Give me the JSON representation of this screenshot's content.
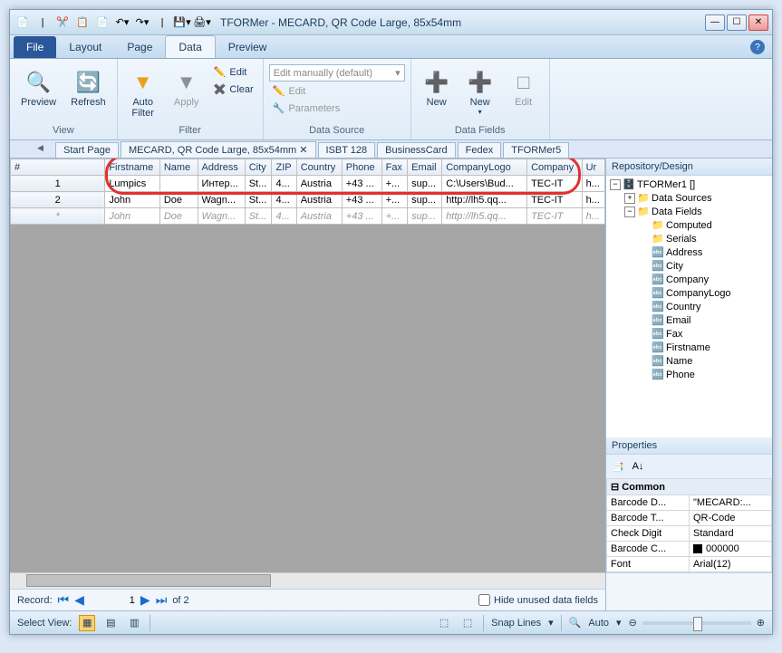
{
  "app": {
    "title": "TFORMer - MECARD, QR Code Large, 85x54mm"
  },
  "tabs": {
    "file": "File",
    "layout": "Layout",
    "page": "Page",
    "data": "Data",
    "preview": "Preview"
  },
  "ribbon": {
    "view": {
      "preview": "Preview",
      "refresh": "Refresh",
      "group": "View"
    },
    "filter": {
      "auto": "Auto\nFilter",
      "apply": "Apply",
      "edit": "Edit",
      "clear": "Clear",
      "group": "Filter"
    },
    "datasource": {
      "combo": "Edit manually (default)",
      "edit": "Edit",
      "params": "Parameters",
      "group": "Data Source"
    },
    "datafields": {
      "new1": "New",
      "new2": "New",
      "edit": "Edit",
      "group": "Data Fields"
    }
  },
  "docTabs": [
    "Start Page",
    "MECARD, QR Code Large, 85x54mm",
    "ISBT 128",
    "BusinessCard",
    "Fedex",
    "TFORMer5"
  ],
  "grid": {
    "headers": [
      "#",
      "Firstname",
      "Name",
      "Address",
      "City",
      "ZIP",
      "Country",
      "Phone",
      "Fax",
      "Email",
      "CompanyLogo",
      "Company",
      "Ur"
    ],
    "rows": [
      [
        "1",
        "Lumpics",
        "",
        "Интер...",
        "St...",
        "4...",
        "Austria",
        "+43 ...",
        "+...",
        "sup...",
        "C:\\Users\\Bud...",
        "TEC-IT",
        "h..."
      ],
      [
        "2",
        "John",
        "Doe",
        "Wagn...",
        "St...",
        "4...",
        "Austria",
        "+43 ...",
        "+...",
        "sup...",
        "http://lh5.qq...",
        "TEC-IT",
        "h..."
      ]
    ],
    "placeholder": [
      "*",
      "John",
      "Doe",
      "Wagn...",
      "St...",
      "4...",
      "Austria",
      "+43 ...",
      "+...",
      "sup...",
      "http://lh5.qq...",
      "TEC-IT",
      "h..."
    ]
  },
  "recordBar": {
    "label": "Record:",
    "current": "1",
    "of": "of 2",
    "hideUnused": "Hide unused data fields"
  },
  "repo": {
    "title": "Repository/Design",
    "root": "TFORMer1 []",
    "folders": [
      "Data Sources",
      "Data Fields",
      "Computed",
      "Serials"
    ],
    "fields": [
      "Address",
      "City",
      "Company",
      "CompanyLogo",
      "Country",
      "Email",
      "Fax",
      "Firstname",
      "Name",
      "Phone"
    ]
  },
  "props": {
    "title": "Properties",
    "category": "Common",
    "rows": [
      [
        "Barcode D...",
        "\"MECARD:..."
      ],
      [
        "Barcode T...",
        "QR-Code"
      ],
      [
        "Check Digit",
        "Standard"
      ],
      [
        "Barcode C...",
        "000000"
      ],
      [
        "Font",
        "Arial(12)"
      ]
    ]
  },
  "status": {
    "selectView": "Select View:",
    "snap": "Snap Lines",
    "auto": "Auto"
  }
}
